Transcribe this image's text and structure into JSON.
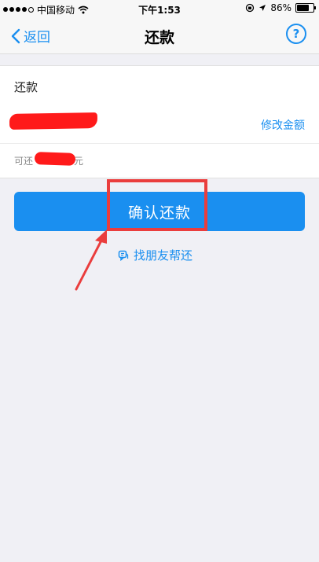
{
  "status_bar": {
    "carrier": "中国移动",
    "time": "下午1:53",
    "battery": "86%",
    "battery_level": 0.86
  },
  "nav": {
    "back_label": "返回",
    "title": "还款",
    "help_label": "?"
  },
  "card": {
    "title": "还款",
    "amount": "",
    "modify_label": "修改金额",
    "available_prefix": "可还",
    "available_suffix": "元"
  },
  "actions": {
    "confirm_label": "确认还款",
    "friend_label": "找朋友帮还"
  },
  "colors": {
    "accent": "#1a8ff0",
    "annotation_red": "#ea3d3d"
  }
}
